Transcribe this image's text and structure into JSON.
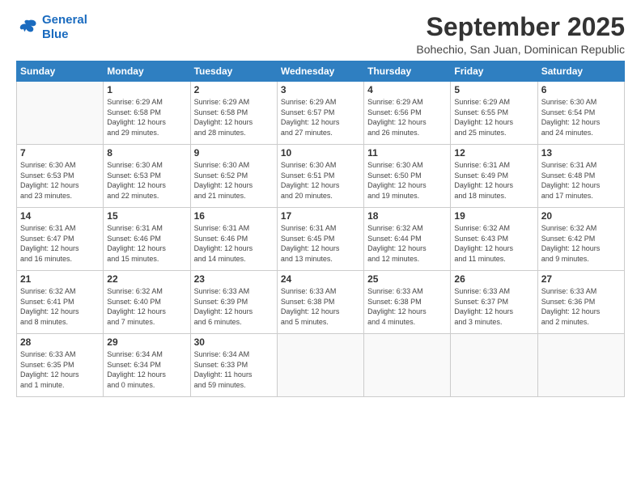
{
  "logo": {
    "line1": "General",
    "line2": "Blue"
  },
  "title": "September 2025",
  "subtitle": "Bohechio, San Juan, Dominican Republic",
  "days_header": [
    "Sunday",
    "Monday",
    "Tuesday",
    "Wednesday",
    "Thursday",
    "Friday",
    "Saturday"
  ],
  "weeks": [
    [
      {
        "day": "",
        "info": ""
      },
      {
        "day": "1",
        "info": "Sunrise: 6:29 AM\nSunset: 6:58 PM\nDaylight: 12 hours\nand 29 minutes."
      },
      {
        "day": "2",
        "info": "Sunrise: 6:29 AM\nSunset: 6:58 PM\nDaylight: 12 hours\nand 28 minutes."
      },
      {
        "day": "3",
        "info": "Sunrise: 6:29 AM\nSunset: 6:57 PM\nDaylight: 12 hours\nand 27 minutes."
      },
      {
        "day": "4",
        "info": "Sunrise: 6:29 AM\nSunset: 6:56 PM\nDaylight: 12 hours\nand 26 minutes."
      },
      {
        "day": "5",
        "info": "Sunrise: 6:29 AM\nSunset: 6:55 PM\nDaylight: 12 hours\nand 25 minutes."
      },
      {
        "day": "6",
        "info": "Sunrise: 6:30 AM\nSunset: 6:54 PM\nDaylight: 12 hours\nand 24 minutes."
      }
    ],
    [
      {
        "day": "7",
        "info": "Sunrise: 6:30 AM\nSunset: 6:53 PM\nDaylight: 12 hours\nand 23 minutes."
      },
      {
        "day": "8",
        "info": "Sunrise: 6:30 AM\nSunset: 6:53 PM\nDaylight: 12 hours\nand 22 minutes."
      },
      {
        "day": "9",
        "info": "Sunrise: 6:30 AM\nSunset: 6:52 PM\nDaylight: 12 hours\nand 21 minutes."
      },
      {
        "day": "10",
        "info": "Sunrise: 6:30 AM\nSunset: 6:51 PM\nDaylight: 12 hours\nand 20 minutes."
      },
      {
        "day": "11",
        "info": "Sunrise: 6:30 AM\nSunset: 6:50 PM\nDaylight: 12 hours\nand 19 minutes."
      },
      {
        "day": "12",
        "info": "Sunrise: 6:31 AM\nSunset: 6:49 PM\nDaylight: 12 hours\nand 18 minutes."
      },
      {
        "day": "13",
        "info": "Sunrise: 6:31 AM\nSunset: 6:48 PM\nDaylight: 12 hours\nand 17 minutes."
      }
    ],
    [
      {
        "day": "14",
        "info": "Sunrise: 6:31 AM\nSunset: 6:47 PM\nDaylight: 12 hours\nand 16 minutes."
      },
      {
        "day": "15",
        "info": "Sunrise: 6:31 AM\nSunset: 6:46 PM\nDaylight: 12 hours\nand 15 minutes."
      },
      {
        "day": "16",
        "info": "Sunrise: 6:31 AM\nSunset: 6:46 PM\nDaylight: 12 hours\nand 14 minutes."
      },
      {
        "day": "17",
        "info": "Sunrise: 6:31 AM\nSunset: 6:45 PM\nDaylight: 12 hours\nand 13 minutes."
      },
      {
        "day": "18",
        "info": "Sunrise: 6:32 AM\nSunset: 6:44 PM\nDaylight: 12 hours\nand 12 minutes."
      },
      {
        "day": "19",
        "info": "Sunrise: 6:32 AM\nSunset: 6:43 PM\nDaylight: 12 hours\nand 11 minutes."
      },
      {
        "day": "20",
        "info": "Sunrise: 6:32 AM\nSunset: 6:42 PM\nDaylight: 12 hours\nand 9 minutes."
      }
    ],
    [
      {
        "day": "21",
        "info": "Sunrise: 6:32 AM\nSunset: 6:41 PM\nDaylight: 12 hours\nand 8 minutes."
      },
      {
        "day": "22",
        "info": "Sunrise: 6:32 AM\nSunset: 6:40 PM\nDaylight: 12 hours\nand 7 minutes."
      },
      {
        "day": "23",
        "info": "Sunrise: 6:33 AM\nSunset: 6:39 PM\nDaylight: 12 hours\nand 6 minutes."
      },
      {
        "day": "24",
        "info": "Sunrise: 6:33 AM\nSunset: 6:38 PM\nDaylight: 12 hours\nand 5 minutes."
      },
      {
        "day": "25",
        "info": "Sunrise: 6:33 AM\nSunset: 6:38 PM\nDaylight: 12 hours\nand 4 minutes."
      },
      {
        "day": "26",
        "info": "Sunrise: 6:33 AM\nSunset: 6:37 PM\nDaylight: 12 hours\nand 3 minutes."
      },
      {
        "day": "27",
        "info": "Sunrise: 6:33 AM\nSunset: 6:36 PM\nDaylight: 12 hours\nand 2 minutes."
      }
    ],
    [
      {
        "day": "28",
        "info": "Sunrise: 6:33 AM\nSunset: 6:35 PM\nDaylight: 12 hours\nand 1 minute."
      },
      {
        "day": "29",
        "info": "Sunrise: 6:34 AM\nSunset: 6:34 PM\nDaylight: 12 hours\nand 0 minutes."
      },
      {
        "day": "30",
        "info": "Sunrise: 6:34 AM\nSunset: 6:33 PM\nDaylight: 11 hours\nand 59 minutes."
      },
      {
        "day": "",
        "info": ""
      },
      {
        "day": "",
        "info": ""
      },
      {
        "day": "",
        "info": ""
      },
      {
        "day": "",
        "info": ""
      }
    ]
  ]
}
